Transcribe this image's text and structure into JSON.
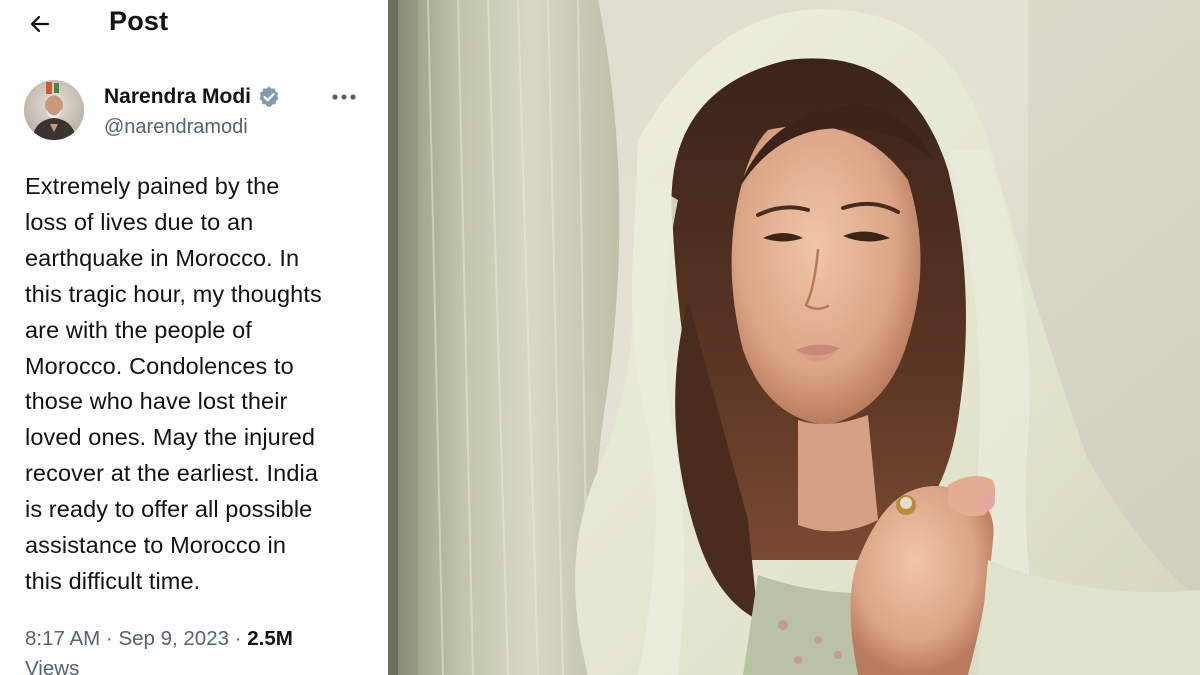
{
  "header": {
    "back_icon": "arrow-left-icon",
    "title": "Post"
  },
  "author": {
    "display_name": "Narendra Modi",
    "handle": "@narendramodi",
    "verified_icon": "verified-badge-icon",
    "verified_color": "#1d9bf0",
    "more_icon": "more-horizontal-icon"
  },
  "post": {
    "lines": [
      "Extremely pained by the",
      "loss of lives due to an",
      "earthquake in Morocco. In",
      "this tragic hour, my thoughts",
      "are with the people of",
      "Morocco. Condolences to",
      "those who have lost their",
      "loved ones. May the injured",
      "recover at the earliest. India",
      "is ready to offer all possible",
      "assistance to Morocco in",
      "this difficult time."
    ],
    "time": "8:17 AM",
    "separator": " · ",
    "date": "Sep 9, 2023",
    "views_count": "2.5M",
    "views_label": "Views"
  },
  "colors": {
    "text_primary": "#0f1419",
    "text_secondary": "#536471"
  }
}
